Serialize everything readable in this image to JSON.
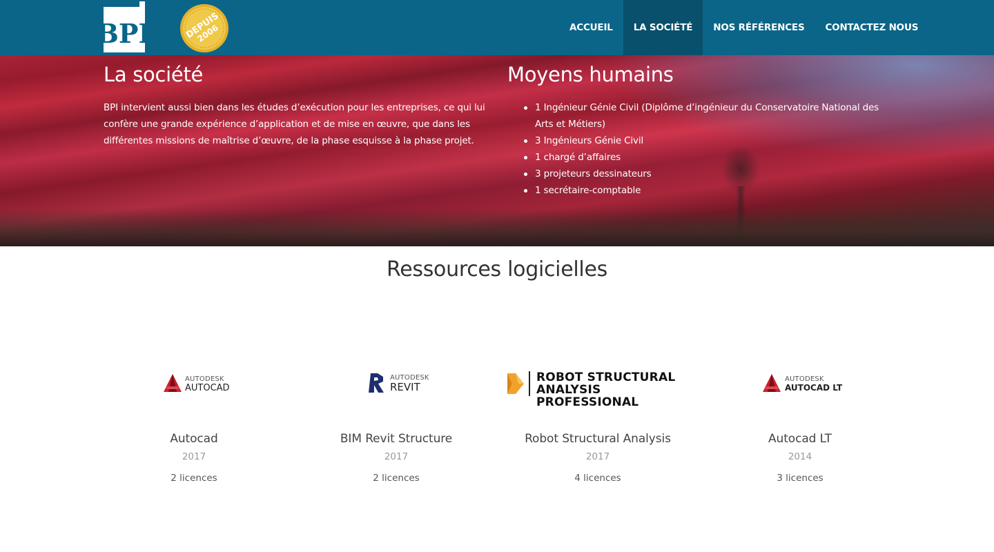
{
  "header": {
    "logo_text": "BPI",
    "seal_text_line1": "DEPUIS",
    "seal_text_line2": "2006",
    "nav": [
      {
        "label": "ACCUEIL",
        "active": false
      },
      {
        "label": "LA SOCIÉTÉ",
        "active": true
      },
      {
        "label": "NOS RÉFÉRENCES",
        "active": false
      },
      {
        "label": "CONTACTEZ NOUS",
        "active": false
      }
    ],
    "colors": {
      "bar": "#0a6589",
      "active": "#08506c"
    }
  },
  "hero": {
    "left": {
      "title": "La société",
      "text": "BPI intervient aussi bien dans les études d’exécution pour les entreprises, ce qui lui confère une grande expérience d’application et de mise en œuvre, que dans les différentes missions de maîtrise d’œuvre, de la phase esquisse à la phase projet."
    },
    "right": {
      "title": "Moyens humains",
      "items": [
        "1 Ingénieur Génie Civil (Diplôme d’ingénieur du Conservatoire National des Arts et Métiers)",
        "3 Ingénieurs Génie Civil",
        "1 chargé d’affaires",
        "3 projeteurs dessinateurs",
        "1 secrétaire-comptable"
      ]
    }
  },
  "software": {
    "title": "Ressources logicielles",
    "items": [
      {
        "name": "Autocad",
        "year": "2017",
        "licences": "2 licences",
        "logo": {
          "vendor": "AUTODESK",
          "product": "AUTOCAD",
          "icon": "autocad-a-icon"
        }
      },
      {
        "name": "BIM Revit Structure",
        "year": "2017",
        "licences": "2 licences",
        "logo": {
          "vendor": "AUTODESK",
          "product": "REVIT",
          "icon": "revit-r-icon"
        }
      },
      {
        "name": "Robot Structural Analysis",
        "year": "2017",
        "licences": "4 licences",
        "logo": {
          "line1": "ROBOT STRUCTURAL",
          "line2": "ANALYSIS PROFESSIONAL",
          "icon": "robot-k-icon"
        }
      },
      {
        "name": "Autocad LT",
        "year": "2014",
        "licences": "3 licences",
        "logo": {
          "vendor": "AUTODESK",
          "product": "AUTOCAD LT",
          "icon": "autocad-a-icon"
        }
      }
    ]
  }
}
